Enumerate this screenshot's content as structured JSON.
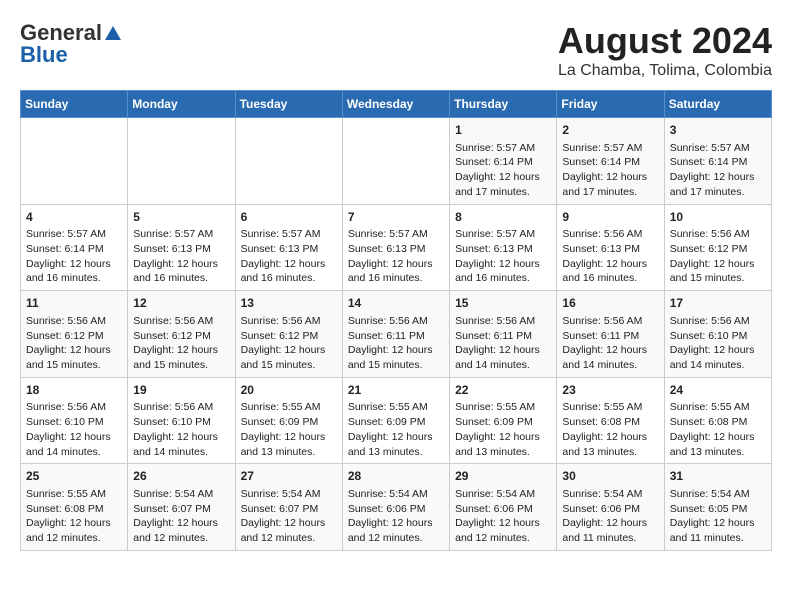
{
  "header": {
    "logo_general": "General",
    "logo_blue": "Blue",
    "month_year": "August 2024",
    "location": "La Chamba, Tolima, Colombia"
  },
  "weekdays": [
    "Sunday",
    "Monday",
    "Tuesday",
    "Wednesday",
    "Thursday",
    "Friday",
    "Saturday"
  ],
  "weeks": [
    [
      {
        "day": "",
        "content": ""
      },
      {
        "day": "",
        "content": ""
      },
      {
        "day": "",
        "content": ""
      },
      {
        "day": "",
        "content": ""
      },
      {
        "day": "1",
        "content": "Sunrise: 5:57 AM\nSunset: 6:14 PM\nDaylight: 12 hours\nand 17 minutes."
      },
      {
        "day": "2",
        "content": "Sunrise: 5:57 AM\nSunset: 6:14 PM\nDaylight: 12 hours\nand 17 minutes."
      },
      {
        "day": "3",
        "content": "Sunrise: 5:57 AM\nSunset: 6:14 PM\nDaylight: 12 hours\nand 17 minutes."
      }
    ],
    [
      {
        "day": "4",
        "content": "Sunrise: 5:57 AM\nSunset: 6:14 PM\nDaylight: 12 hours\nand 16 minutes."
      },
      {
        "day": "5",
        "content": "Sunrise: 5:57 AM\nSunset: 6:13 PM\nDaylight: 12 hours\nand 16 minutes."
      },
      {
        "day": "6",
        "content": "Sunrise: 5:57 AM\nSunset: 6:13 PM\nDaylight: 12 hours\nand 16 minutes."
      },
      {
        "day": "7",
        "content": "Sunrise: 5:57 AM\nSunset: 6:13 PM\nDaylight: 12 hours\nand 16 minutes."
      },
      {
        "day": "8",
        "content": "Sunrise: 5:57 AM\nSunset: 6:13 PM\nDaylight: 12 hours\nand 16 minutes."
      },
      {
        "day": "9",
        "content": "Sunrise: 5:56 AM\nSunset: 6:13 PM\nDaylight: 12 hours\nand 16 minutes."
      },
      {
        "day": "10",
        "content": "Sunrise: 5:56 AM\nSunset: 6:12 PM\nDaylight: 12 hours\nand 15 minutes."
      }
    ],
    [
      {
        "day": "11",
        "content": "Sunrise: 5:56 AM\nSunset: 6:12 PM\nDaylight: 12 hours\nand 15 minutes."
      },
      {
        "day": "12",
        "content": "Sunrise: 5:56 AM\nSunset: 6:12 PM\nDaylight: 12 hours\nand 15 minutes."
      },
      {
        "day": "13",
        "content": "Sunrise: 5:56 AM\nSunset: 6:12 PM\nDaylight: 12 hours\nand 15 minutes."
      },
      {
        "day": "14",
        "content": "Sunrise: 5:56 AM\nSunset: 6:11 PM\nDaylight: 12 hours\nand 15 minutes."
      },
      {
        "day": "15",
        "content": "Sunrise: 5:56 AM\nSunset: 6:11 PM\nDaylight: 12 hours\nand 14 minutes."
      },
      {
        "day": "16",
        "content": "Sunrise: 5:56 AM\nSunset: 6:11 PM\nDaylight: 12 hours\nand 14 minutes."
      },
      {
        "day": "17",
        "content": "Sunrise: 5:56 AM\nSunset: 6:10 PM\nDaylight: 12 hours\nand 14 minutes."
      }
    ],
    [
      {
        "day": "18",
        "content": "Sunrise: 5:56 AM\nSunset: 6:10 PM\nDaylight: 12 hours\nand 14 minutes."
      },
      {
        "day": "19",
        "content": "Sunrise: 5:56 AM\nSunset: 6:10 PM\nDaylight: 12 hours\nand 14 minutes."
      },
      {
        "day": "20",
        "content": "Sunrise: 5:55 AM\nSunset: 6:09 PM\nDaylight: 12 hours\nand 13 minutes."
      },
      {
        "day": "21",
        "content": "Sunrise: 5:55 AM\nSunset: 6:09 PM\nDaylight: 12 hours\nand 13 minutes."
      },
      {
        "day": "22",
        "content": "Sunrise: 5:55 AM\nSunset: 6:09 PM\nDaylight: 12 hours\nand 13 minutes."
      },
      {
        "day": "23",
        "content": "Sunrise: 5:55 AM\nSunset: 6:08 PM\nDaylight: 12 hours\nand 13 minutes."
      },
      {
        "day": "24",
        "content": "Sunrise: 5:55 AM\nSunset: 6:08 PM\nDaylight: 12 hours\nand 13 minutes."
      }
    ],
    [
      {
        "day": "25",
        "content": "Sunrise: 5:55 AM\nSunset: 6:08 PM\nDaylight: 12 hours\nand 12 minutes."
      },
      {
        "day": "26",
        "content": "Sunrise: 5:54 AM\nSunset: 6:07 PM\nDaylight: 12 hours\nand 12 minutes."
      },
      {
        "day": "27",
        "content": "Sunrise: 5:54 AM\nSunset: 6:07 PM\nDaylight: 12 hours\nand 12 minutes."
      },
      {
        "day": "28",
        "content": "Sunrise: 5:54 AM\nSunset: 6:06 PM\nDaylight: 12 hours\nand 12 minutes."
      },
      {
        "day": "29",
        "content": "Sunrise: 5:54 AM\nSunset: 6:06 PM\nDaylight: 12 hours\nand 12 minutes."
      },
      {
        "day": "30",
        "content": "Sunrise: 5:54 AM\nSunset: 6:06 PM\nDaylight: 12 hours\nand 11 minutes."
      },
      {
        "day": "31",
        "content": "Sunrise: 5:54 AM\nSunset: 6:05 PM\nDaylight: 12 hours\nand 11 minutes."
      }
    ]
  ]
}
